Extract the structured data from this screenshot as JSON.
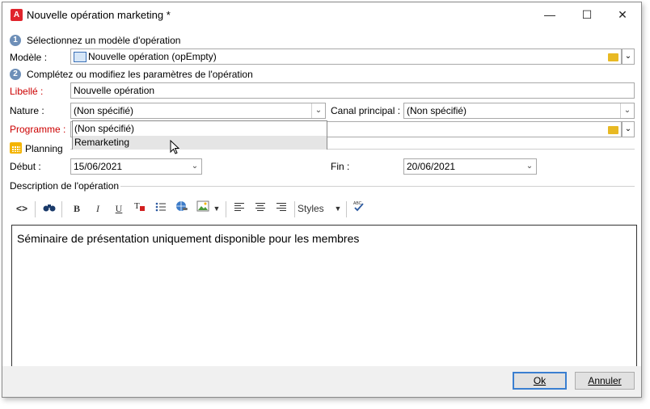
{
  "window": {
    "title": "Nouvelle opération marketing *",
    "minimize_icon": "minimize-icon",
    "maximize_icon": "maximize-icon",
    "close_icon": "close-icon"
  },
  "step1": {
    "number": "1",
    "label": "Sélectionnez un modèle d'opération"
  },
  "modele": {
    "label": "Modèle :",
    "value": "Nouvelle opération (opEmpty)"
  },
  "step2": {
    "number": "2",
    "label": "Complétez ou modifiez les paramètres de l'opération"
  },
  "libelle": {
    "label": "Libellé :",
    "value": "Nouvelle opération"
  },
  "nature": {
    "label": "Nature :",
    "value": "(Non spécifié)",
    "options": [
      "(Non spécifié)",
      "Remarketing"
    ],
    "highlighted": "Remarketing"
  },
  "canal": {
    "label": "Canal principal :",
    "value": "(Non spécifié)"
  },
  "programme": {
    "label": "Programme :",
    "value": ""
  },
  "planning": {
    "label": "Planning"
  },
  "debut": {
    "label": "Début :",
    "value": "15/06/2021"
  },
  "fin": {
    "label": "Fin :",
    "value": "20/06/2021"
  },
  "description": {
    "label": "Description de l'opération",
    "content": "Séminaire de présentation uniquement disponible pour les membres"
  },
  "toolbar": {
    "source_icon": "source-code-icon",
    "find_icon": "binoculars-icon",
    "bold": "B",
    "italic": "I",
    "underline": "U",
    "text_color_icon": "text-color-icon",
    "list_icon": "bullet-list-icon",
    "link_icon": "link-icon",
    "image_icon": "image-icon",
    "align_left_icon": "align-left-icon",
    "align_center_icon": "align-center-icon",
    "align_right_icon": "align-right-icon",
    "styles_label": "Styles",
    "spellcheck_icon": "spellcheck-icon"
  },
  "buttons": {
    "ok": "Ok",
    "cancel": "Annuler"
  },
  "colors": {
    "required_label": "#cc0000",
    "step_badge": "#6e8fb8",
    "default_button_border": "#3a7fd0"
  }
}
